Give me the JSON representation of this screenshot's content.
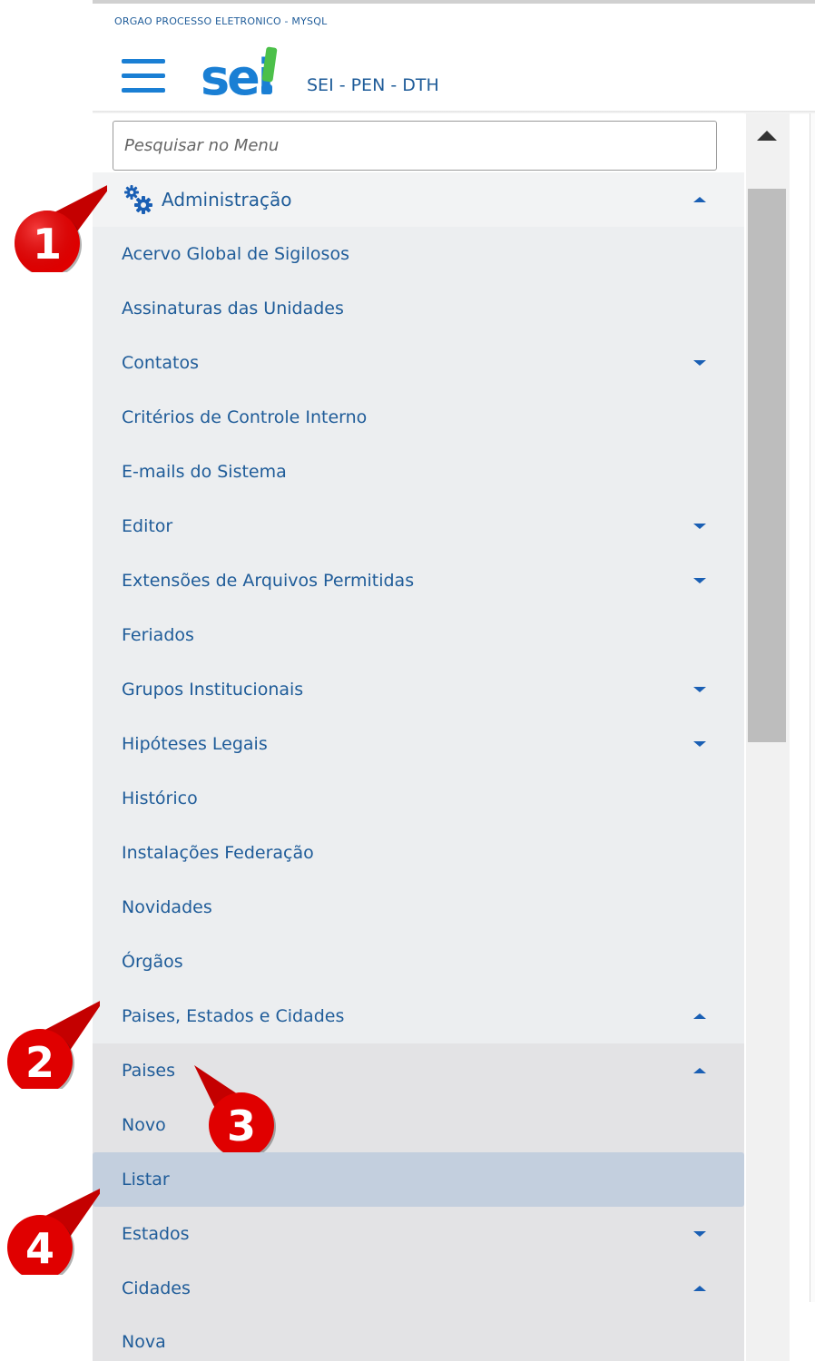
{
  "header": {
    "org_name": "ORGAO PROCESSO ELETRONICO - MYSQL",
    "logo_text": "sei!",
    "system_title": "SEI - PEN - DTH"
  },
  "search": {
    "placeholder": "Pesquisar no Menu"
  },
  "menu": {
    "section_title": "Administração",
    "items": [
      "Acervo Global de Sigilosos",
      "Assinaturas das Unidades",
      "Contatos",
      "Critérios de Controle Interno",
      "E-mails do Sistema",
      "Editor",
      "Extensões de Arquivos Permitidas",
      "Feriados",
      "Grupos Institucionais",
      "Hipóteses Legais",
      "Histórico",
      "Instalações Federação",
      "Novidades",
      "Órgãos",
      "Paises, Estados e Cidades"
    ],
    "sub_items": [
      "Paises",
      "Novo",
      "Listar",
      "Estados",
      "Cidades",
      "Nova"
    ]
  },
  "callouts": [
    "1",
    "2",
    "3",
    "4"
  ],
  "colors": {
    "accent": "#1a7fd4",
    "link": "#1f5c99",
    "callout_red": "#e00000",
    "active_row": "#c3cfde"
  }
}
